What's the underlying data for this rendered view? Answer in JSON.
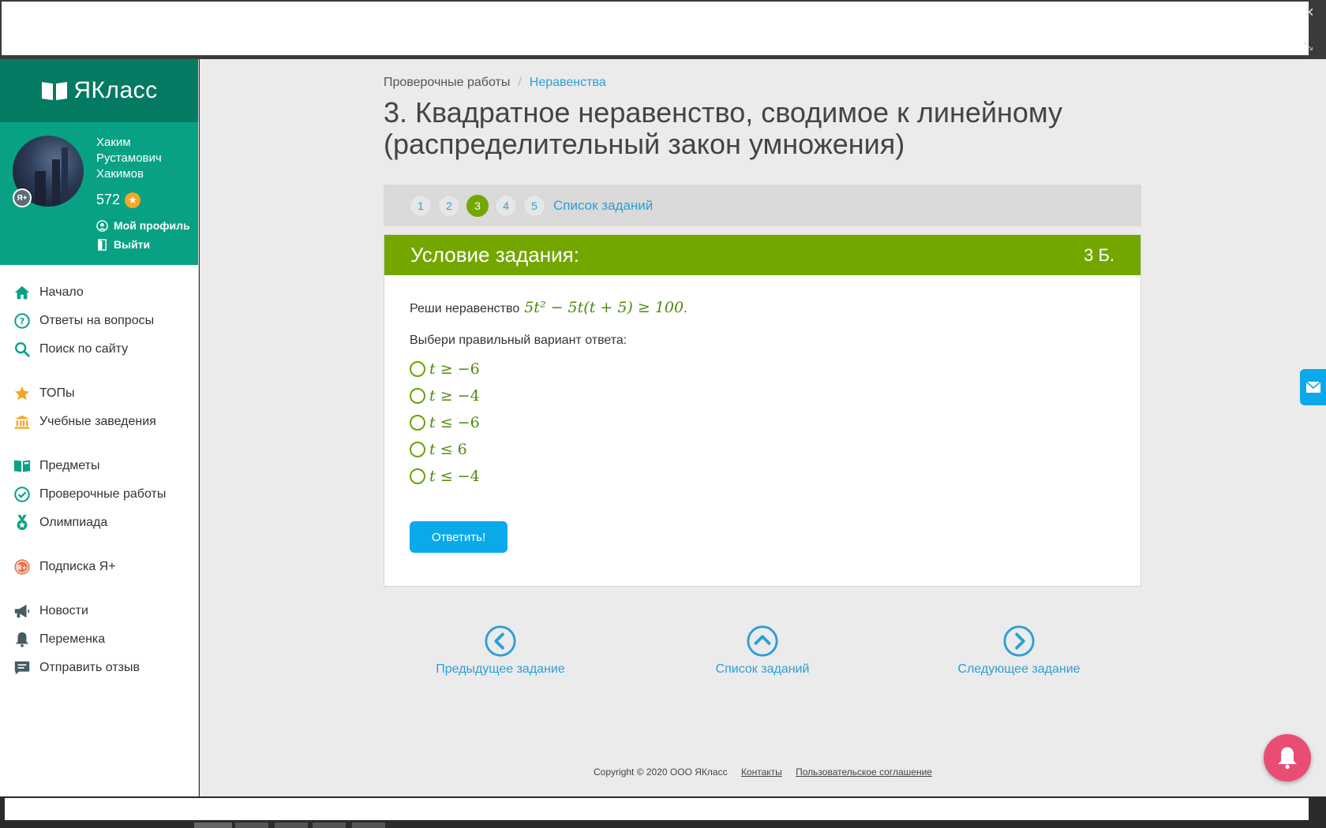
{
  "brand": {
    "name": "ЯКласс"
  },
  "user": {
    "name": "Хаким Рустамович Хакимов",
    "points": "572",
    "badge": "Я+",
    "profile_link": "Мой профиль",
    "logout_link": "Выйти"
  },
  "nav": {
    "groups": [
      [
        {
          "label": "Начало"
        },
        {
          "label": "Ответы на вопросы"
        },
        {
          "label": "Поиск по сайту"
        }
      ],
      [
        {
          "label": "ТОПы"
        },
        {
          "label": "Учебные заведения"
        }
      ],
      [
        {
          "label": "Предметы"
        },
        {
          "label": "Проверочные работы"
        },
        {
          "label": "Олимпиада"
        }
      ],
      [
        {
          "label": "Подписка Я+"
        }
      ],
      [
        {
          "label": "Новости"
        },
        {
          "label": "Переменка"
        },
        {
          "label": "Отправить отзыв"
        }
      ]
    ]
  },
  "breadcrumb": {
    "parent": "Проверочные работы",
    "separator": "/",
    "current": "Неравенства"
  },
  "page_title": "3. Квадратное неравенство, сводимое к линейному (распределительный закон умножения)",
  "pagination": {
    "pages": [
      "1",
      "2",
      "3",
      "4",
      "5"
    ],
    "active": "3",
    "task_list": "Список заданий"
  },
  "task": {
    "header": "Условие задания:",
    "points": "3 Б.",
    "statement_prefix": "Реши неравенство",
    "statement_math": "5t² − 5t(t + 5) ≥ 100",
    "statement_suffix": ".",
    "choose_label": "Выбери правильный вариант ответа:",
    "options": [
      {
        "var": "t",
        "op": "≥",
        "val": "−6"
      },
      {
        "var": "t",
        "op": "≥",
        "val": "−4"
      },
      {
        "var": "t",
        "op": "≤",
        "val": "−6"
      },
      {
        "var": "t",
        "op": "≤",
        "val": "6"
      },
      {
        "var": "t",
        "op": "≤",
        "val": "−4"
      }
    ],
    "submit_label": "Ответить!"
  },
  "bottom_nav": {
    "prev": "Предыдущее задание",
    "list": "Список заданий",
    "next": "Следующее задание"
  },
  "footer": {
    "copyright": "Copyright © 2020 ООО ЯКласс",
    "contacts": "Контакты",
    "agreement": "Пользовательское соглашение"
  },
  "colors": {
    "brand_green": "#08a184",
    "task_green": "#73a700",
    "link_blue": "#2a9fd6",
    "button_blue": "#0ba9e9",
    "bell_pink": "#e94d73"
  }
}
